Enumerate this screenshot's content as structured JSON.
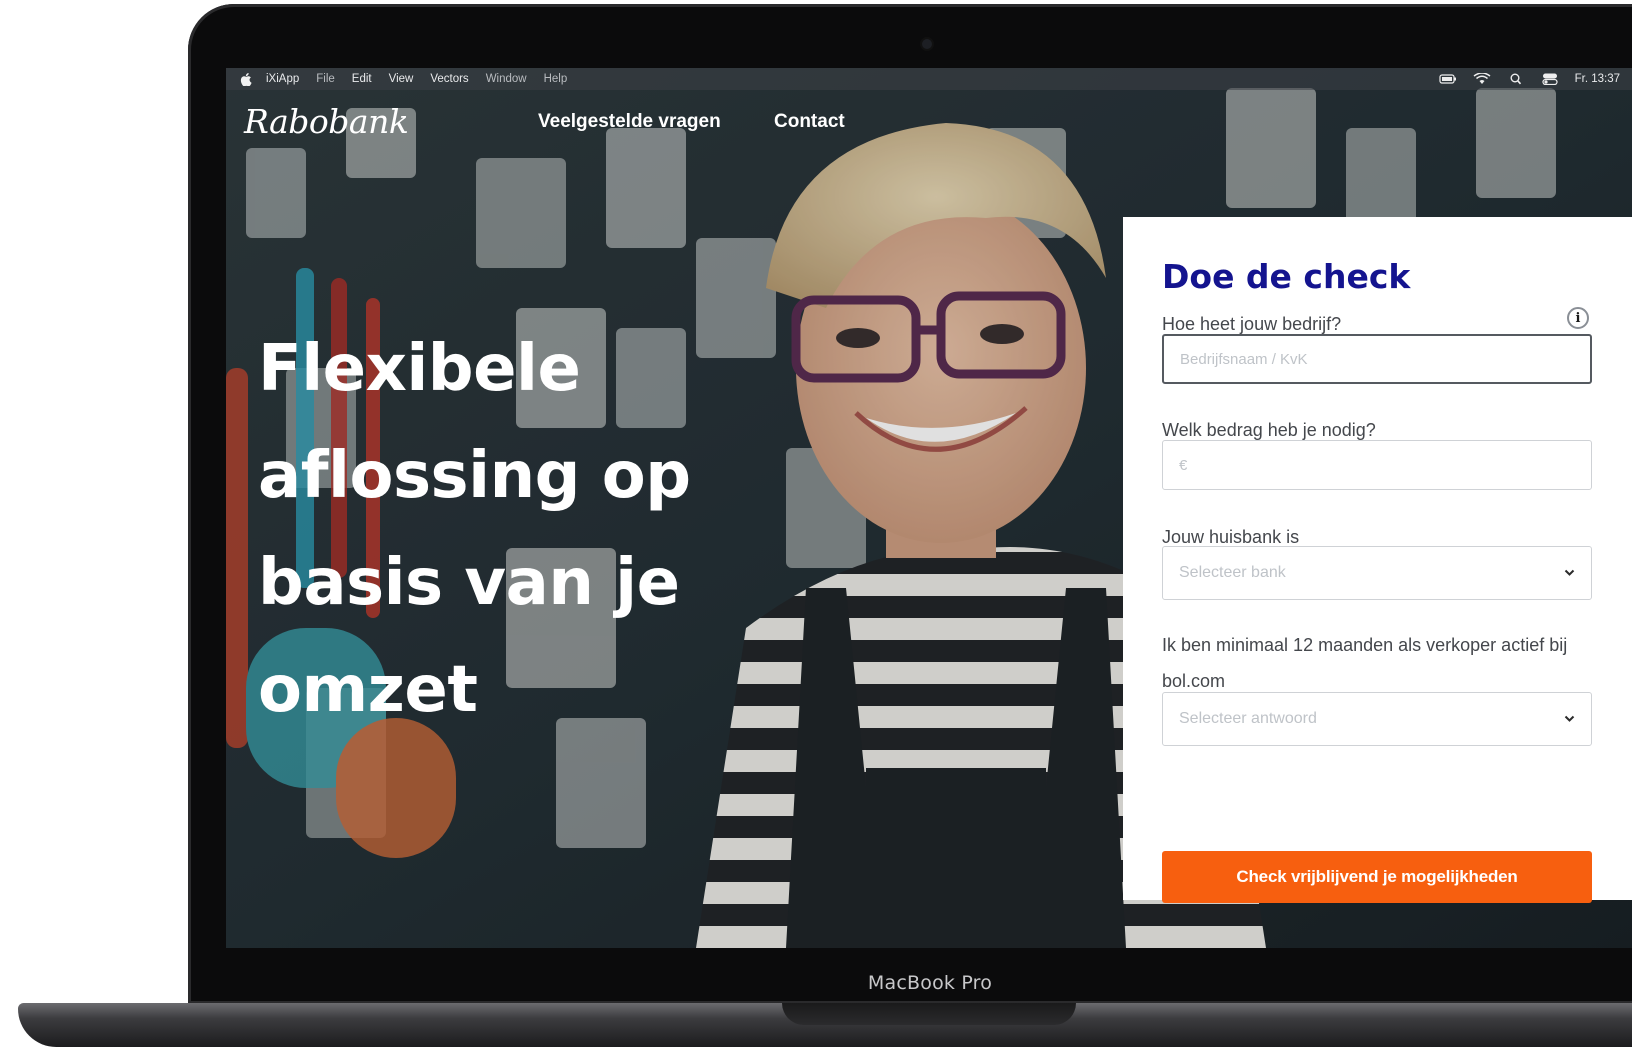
{
  "device": {
    "label": "MacBook Pro"
  },
  "menubar": {
    "items": [
      "iXiApp",
      "File",
      "Edit",
      "View",
      "Vectors",
      "Window",
      "Help"
    ],
    "clock": "Fr. 13:37"
  },
  "site": {
    "logo": "Rabobank",
    "nav": {
      "faq": "Veelgestelde vragen",
      "contact": "Contact"
    },
    "hero": "Flexibele aflossing op basis van je omzet"
  },
  "form": {
    "title": "Doe de check",
    "company_label": "Hoe heet jouw bedrijf?",
    "company_placeholder": "Bedrijfsnaam / KvK",
    "amount_label": "Welk bedrag heb je nodig?",
    "amount_placeholder": "€",
    "bank_label": "Jouw huisbank is",
    "bank_placeholder": "Selecteer bank",
    "seller_label": "Ik ben minimaal 12 maanden als verkoper actief bij bol.com",
    "seller_placeholder": "Selecteer antwoord",
    "submit_label": "Check vrijblijvend je mogelijkheden"
  },
  "colors": {
    "title": "#14148f",
    "cta": "#f75f0f",
    "text": "#44474c"
  },
  "icons": {
    "info": "info-circle-icon",
    "chevron": "chevron-down-icon",
    "apple": "apple-logo-icon"
  }
}
